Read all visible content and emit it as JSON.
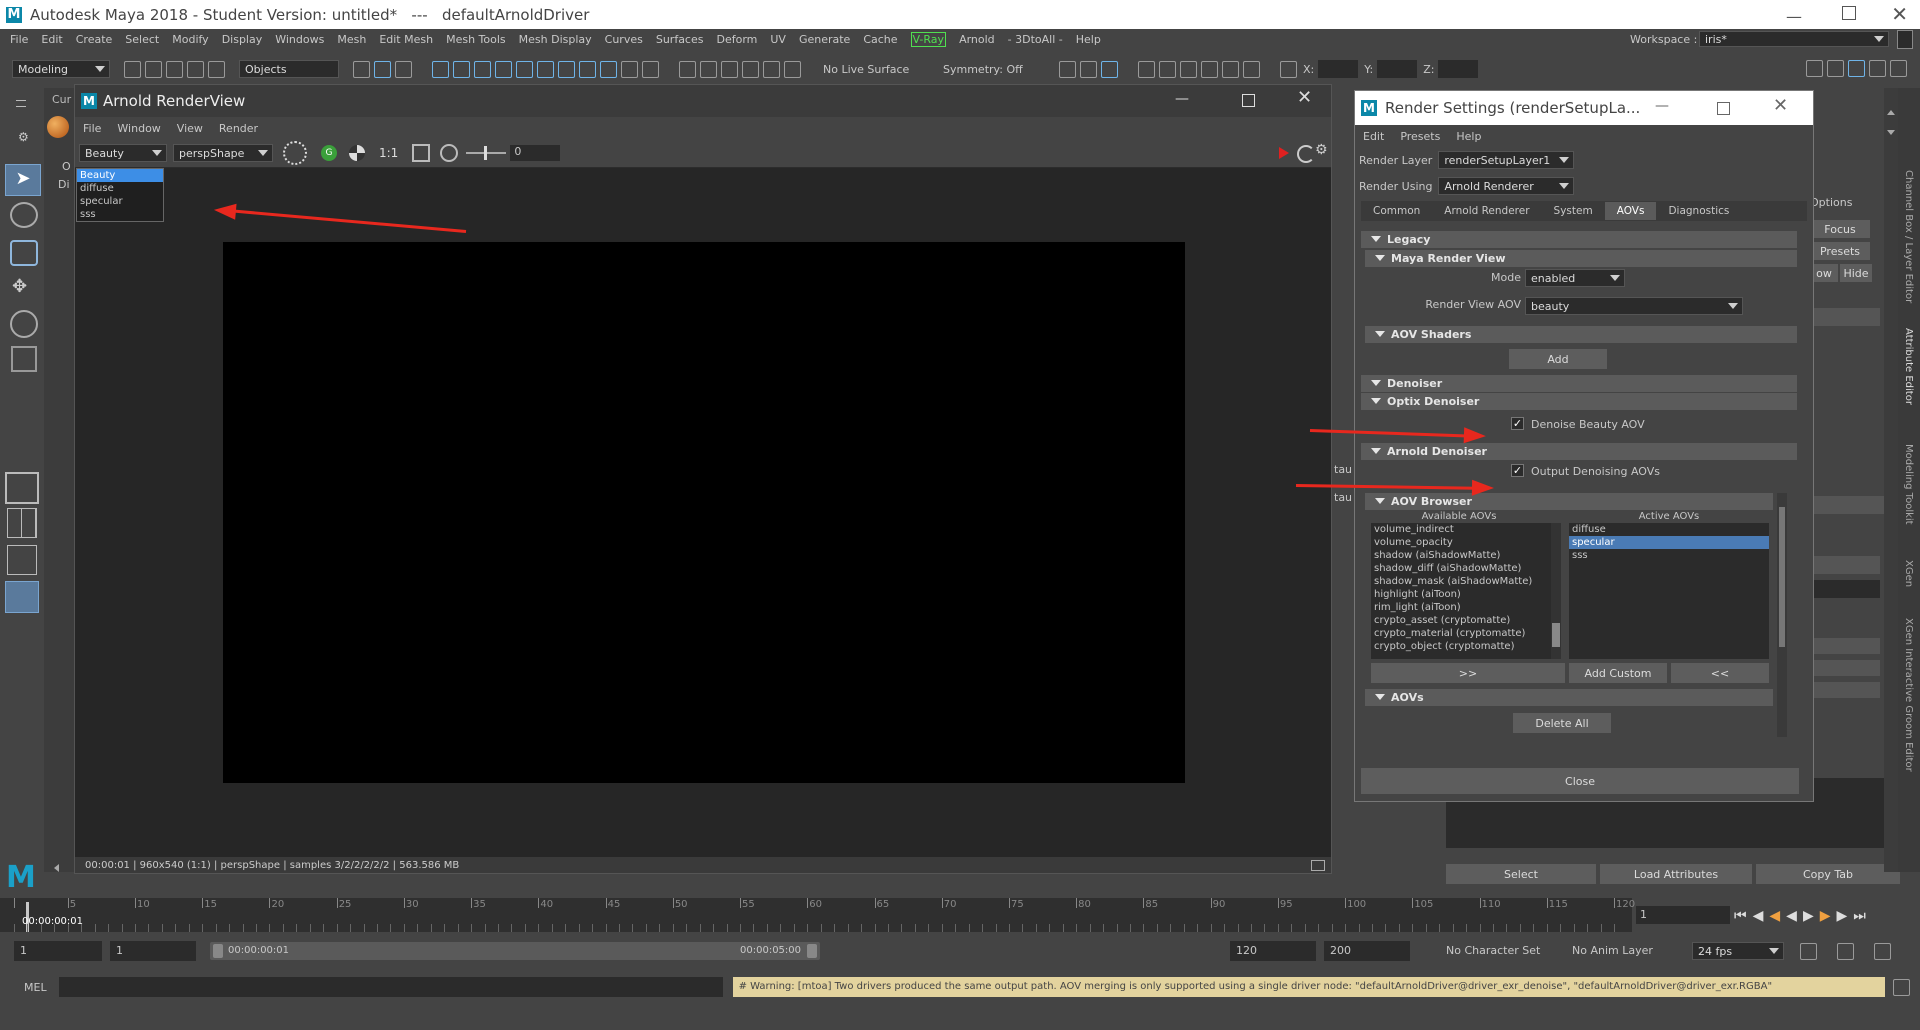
{
  "titlebar": {
    "title": "Autodesk Maya 2018 - Student Version: untitled*   ---   defaultArnoldDriver"
  },
  "menubar": {
    "items": [
      "File",
      "Edit",
      "Create",
      "Select",
      "Modify",
      "Display",
      "Windows",
      "Mesh",
      "Edit Mesh",
      "Mesh Tools",
      "Mesh Display",
      "Curves",
      "Surfaces",
      "Deform",
      "UV",
      "Generate",
      "Cache",
      "V-Ray",
      "Arnold",
      "- 3DtoAll -",
      "Help"
    ],
    "workspace_label": "Workspace :",
    "workspace_value": "iris*"
  },
  "statusline": {
    "mode": "Modeling",
    "objects_label": "Objects",
    "live_surface": "No Live Surface",
    "symmetry": "Symmetry: Off",
    "x_label": "X:",
    "y_label": "Y:",
    "z_label": "Z:"
  },
  "renderview": {
    "title": "Arnold RenderView",
    "menu": [
      "File",
      "Window",
      "View",
      "Render"
    ],
    "aov_selected": "Beauty",
    "aov_options": [
      "Beauty",
      "diffuse",
      "specular",
      "sss"
    ],
    "camera": "perspShape",
    "ratio": "1:1",
    "exposure": "0",
    "status": "00:00:01 | 960x540 (1:1) | perspShape  | samples 3/2/2/2/2/2 | 563.586 MB"
  },
  "left_panel_fragments": {
    "a": "Cur",
    "b": "O",
    "c": "Di"
  },
  "render_settings": {
    "title": "Render Settings (renderSetupLa...",
    "menu": [
      "Edit",
      "Presets",
      "Help"
    ],
    "render_layer_label": "Render Layer",
    "render_layer_value": "renderSetupLayer1",
    "render_using_label": "Render Using",
    "render_using_value": "Arnold Renderer",
    "tabs": [
      "Common",
      "Arnold Renderer",
      "System",
      "AOVs",
      "Diagnostics"
    ],
    "active_tab": "AOVs",
    "sections": {
      "legacy": "Legacy",
      "maya_render_view": "Maya Render View",
      "aov_shaders": "AOV Shaders",
      "denoiser": "Denoiser",
      "optix": "Optix Denoiser",
      "arnold_denoiser": "Arnold Denoiser",
      "aov_browser": "AOV Browser",
      "aovs": "AOVs"
    },
    "mode_label": "Mode",
    "mode_value": "enabled",
    "rv_aov_label": "Render View AOV",
    "rv_aov_value": "beauty",
    "add_label": "Add",
    "denoise_beauty_label": "Denoise Beauty AOV",
    "output_denoising_label": "Output Denoising AOVs",
    "available_header": "Available AOVs",
    "active_header": "Active AOVs",
    "available": [
      "volume_indirect",
      "volume_opacity",
      "shadow (aiShadowMatte)",
      "shadow_diff (aiShadowMatte)",
      "shadow_mask (aiShadowMatte)",
      "highlight (aiToon)",
      "rim_light (aiToon)",
      "crypto_asset (cryptomatte)",
      "crypto_material (cryptomatte)",
      "crypto_object (cryptomatte)"
    ],
    "active": [
      "diffuse",
      "specular",
      "sss"
    ],
    "active_selected": "specular",
    "move_right": ">>",
    "add_custom": "Add Custom",
    "move_left": "<<",
    "delete_all": "Delete All",
    "close": "Close"
  },
  "attr_editor": {
    "options": "Options",
    "focus": "Focus",
    "presets": "Presets",
    "show": "ow",
    "hide": "Hide",
    "select": "Select",
    "load": "Load Attributes",
    "copy": "Copy Tab",
    "partial_a": "tau",
    "partial_b": "tau"
  },
  "side_tabs": [
    "Channel Box / Layer Editor",
    "Attribute Editor",
    "Modeling Toolkit",
    "XGen",
    "XGen Interactive Groom Editor"
  ],
  "timeline": {
    "ticks": [
      1,
      5,
      10,
      15,
      20,
      25,
      30,
      35,
      40,
      45,
      50,
      55,
      60,
      65,
      70,
      75,
      80,
      85,
      90,
      95,
      100,
      105,
      110,
      115,
      120
    ],
    "current_time": "00:00:00:01",
    "current_frame": "1"
  },
  "range": {
    "start_outer": "1",
    "start_inner": "1",
    "range_start": "00:00:00:01",
    "range_end": "00:00:05:00",
    "end_inner": "120",
    "end_outer": "200",
    "character_set": "No Character Set",
    "anim_layer": "No Anim Layer",
    "fps": "24 fps"
  },
  "commandline": {
    "mel": "MEL",
    "warning": "# Warning: [mtoa] Two drivers produced the same output path. AOV merging is only supported using a single driver node: \"defaultArnoldDriver@driver_exr_denoise\", \"defaultArnoldDriver@driver_exr.RGBA\""
  },
  "colors": {
    "accent": "#4a7bb5",
    "annotation": "#e8281e",
    "warning_bg": "#e3d39e"
  }
}
